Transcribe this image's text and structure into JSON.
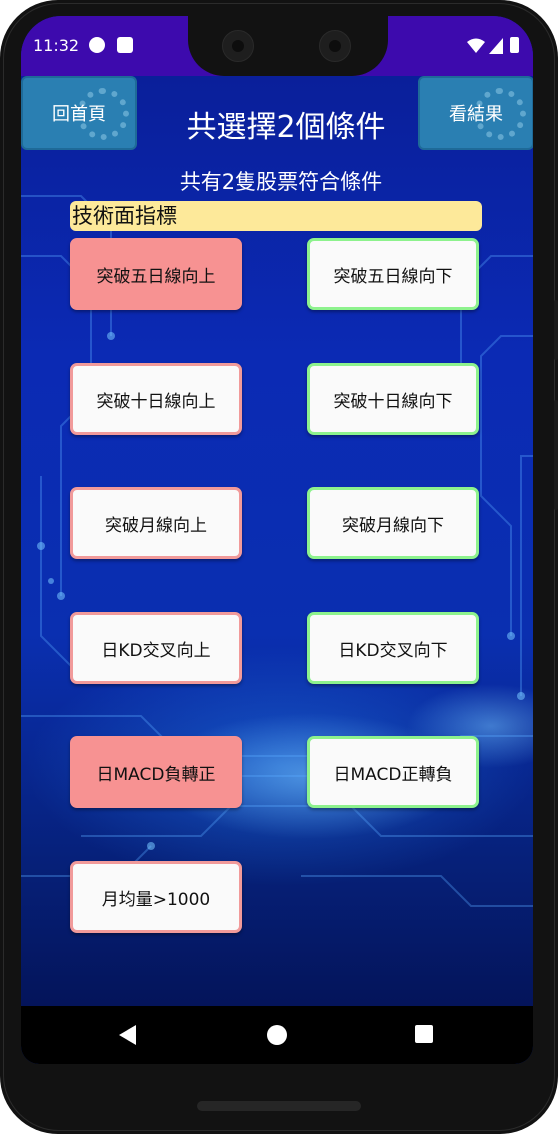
{
  "status_bar": {
    "time": "11:32"
  },
  "header": {
    "home_button": "回首頁",
    "title": "共選擇2個條件",
    "results_button": "看結果"
  },
  "subtitle": "共有2隻股票符合條件",
  "section_title": "技術面指標",
  "options": [
    {
      "label": "突破五日線向上",
      "selected": true
    },
    {
      "label": "突破五日線向下",
      "selected": false
    },
    {
      "label": "突破十日線向上",
      "selected": false
    },
    {
      "label": "突破十日線向下",
      "selected": false
    },
    {
      "label": "突破月線向上",
      "selected": false
    },
    {
      "label": "突破月線向下",
      "selected": false
    },
    {
      "label": "日KD交叉向上",
      "selected": false
    },
    {
      "label": "日KD交叉向下",
      "selected": false
    },
    {
      "label": "日MACD負轉正",
      "selected": true
    },
    {
      "label": "日MACD正轉負",
      "selected": false
    },
    {
      "label": "月均量>1000",
      "selected": false
    }
  ],
  "colors": {
    "status_bar": "#3d0aad",
    "header_button": "#2a7fb2",
    "section_bar": "#fde99a",
    "selected_option": "#f79292",
    "up_border": "#f19a9a",
    "down_border": "#8df28d"
  },
  "nav": {
    "back_icon": "back-triangle-icon",
    "home_icon": "home-circle-icon",
    "recents_icon": "recents-square-icon"
  }
}
